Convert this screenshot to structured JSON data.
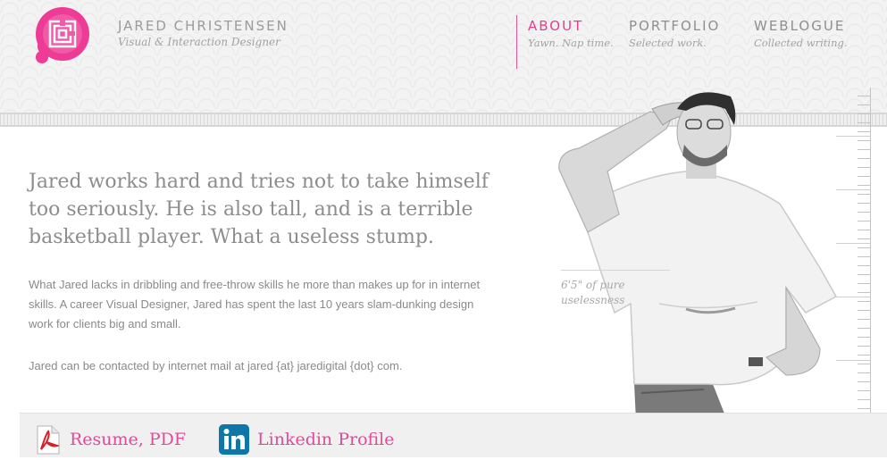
{
  "header": {
    "name": "JARED CHRISTENSEN",
    "tagline": "Visual & Interaction Designer",
    "logo_icon": "wax-seal-maze-logo",
    "accent_color": "#e73c8f"
  },
  "nav": {
    "items": [
      {
        "label": "ABOUT",
        "sub": "Yawn. Nap time.",
        "active": true
      },
      {
        "label": "PORTFOLIO",
        "sub": "Selected work.",
        "active": false
      },
      {
        "label": "WEBLOGUE",
        "sub": "Collected writing.",
        "active": false
      }
    ]
  },
  "main": {
    "intro": "Jared works hard and tries not to take himself too seriously. He is also tall, and is a terrible basketball player.  What a useless stump.",
    "para1": "What Jared lacks in dribbling and free-throw skills he more than makes up for in internet skills. A career Visual Designer, Jared has spent the last 10 years slam-dunking design work for clients big and small.",
    "para2": "Jared can be contacted by internet mail at jared {at} jaredigital {dot} com."
  },
  "height": {
    "caption_line1": "6'5\" of pure",
    "caption_line2": "uselessness"
  },
  "links": {
    "resume": {
      "label": "Resume, PDF",
      "icon": "pdf-icon"
    },
    "linkedin": {
      "label": "Linkedin Profile",
      "icon": "linkedin-icon"
    }
  }
}
